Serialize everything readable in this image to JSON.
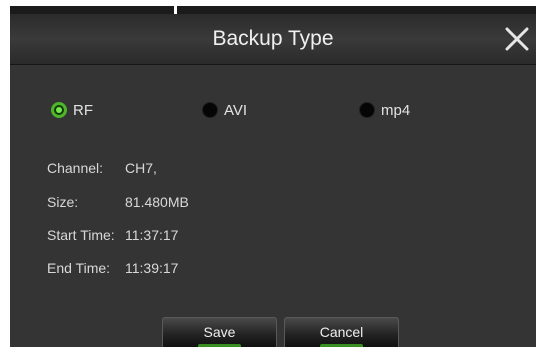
{
  "dialog": {
    "title": "Backup Type",
    "close_icon": "close-icon"
  },
  "formats": [
    {
      "label": "RF",
      "selected": true
    },
    {
      "label": "AVI",
      "selected": false
    },
    {
      "label": "mp4",
      "selected": false
    }
  ],
  "info": {
    "channel_label": "Channel:",
    "channel_value": "CH7,",
    "size_label": "Size:",
    "size_value": "81.480MB",
    "start_label": "Start Time:",
    "start_value": "11:37:17",
    "end_label": "End Time:",
    "end_value": "11:39:17"
  },
  "buttons": {
    "save_label": "Save",
    "cancel_label": "Cancel"
  },
  "colors": {
    "dialog_bg": "#343434",
    "radio_selected": "#4fb52a",
    "button_accent": "#3a8f22"
  }
}
